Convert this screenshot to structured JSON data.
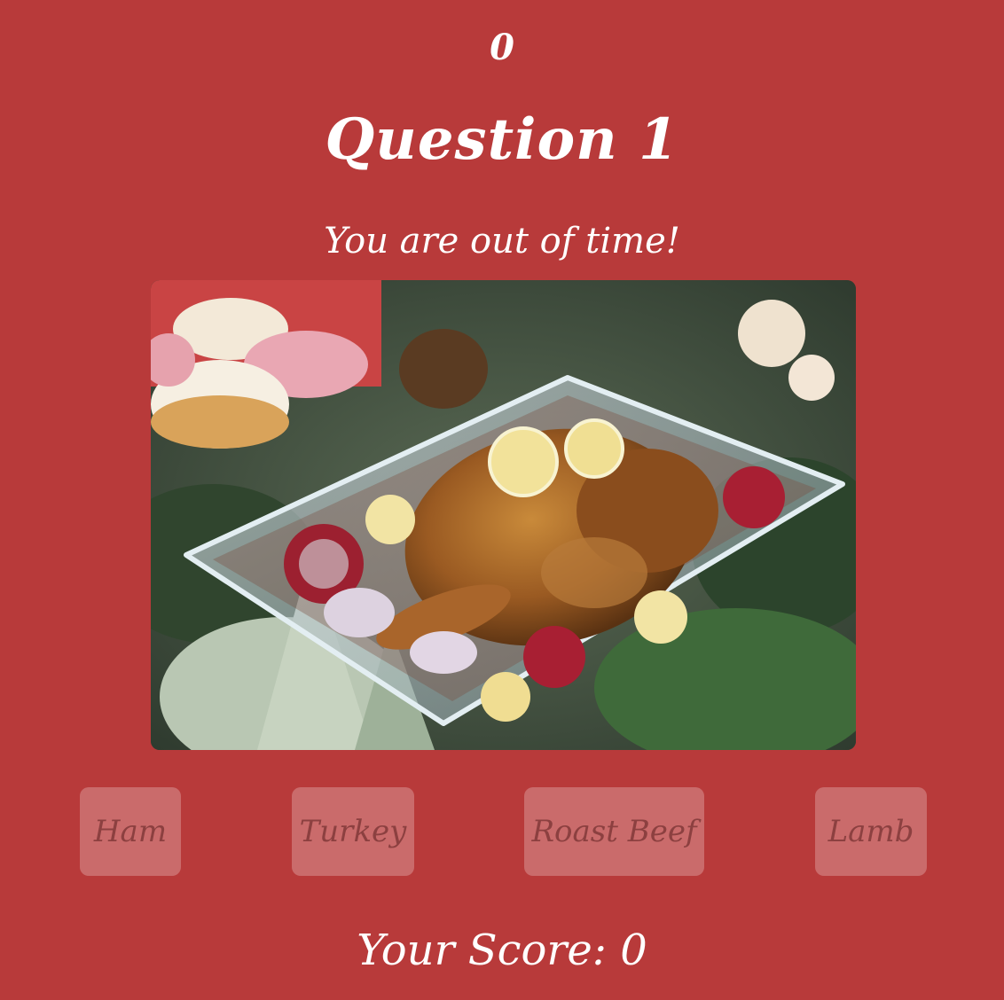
{
  "timer": "0",
  "question": {
    "title": "Question 1",
    "status": "You are out of time!"
  },
  "image": {
    "subject": "roast-poultry-dish"
  },
  "answers": [
    {
      "label": "Ham"
    },
    {
      "label": "Turkey"
    },
    {
      "label": "Roast Beef"
    },
    {
      "label": "Lamb"
    }
  ],
  "score": {
    "text": "Your Score: 0"
  },
  "colors": {
    "background": "#b83a3a",
    "text": "#ffffff",
    "answer_bg": "rgba(255,255,255,0.25)",
    "answer_text": "rgba(90,30,30,0.55)"
  }
}
